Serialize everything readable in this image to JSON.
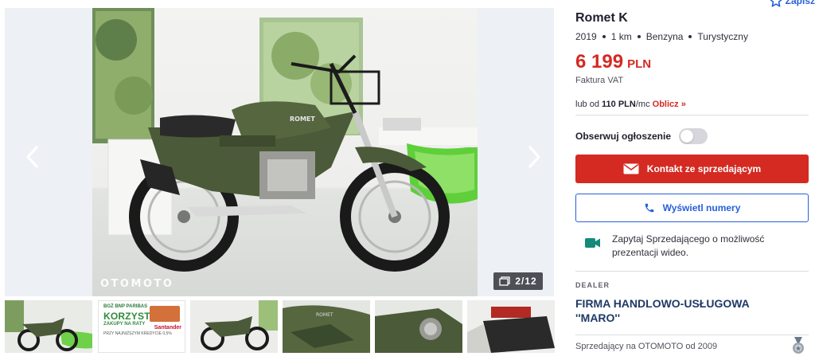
{
  "listing": {
    "title": "Romet K",
    "params": [
      "2019",
      "1 km",
      "Benzyna",
      "Turystyczny"
    ],
    "price_value": "6 199",
    "price_currency": "PLN",
    "vat_note": "Faktura VAT"
  },
  "financing": {
    "prefix": "lub od",
    "amount": "110 PLN",
    "suffix": "/mc",
    "calc_link": "Oblicz »"
  },
  "observe": {
    "label": "Obserwuj ogłoszenie",
    "enabled": false
  },
  "actions": {
    "contact_label": "Kontakt ze sprzedającym",
    "phone_label": "Wyświetl numery",
    "save_label": "Zapisz"
  },
  "video": {
    "text": "Zapytaj Sprzedającego o możliwość prezentacji wideo."
  },
  "dealer": {
    "section_label": "DEALER",
    "name": "FIRMA HANDLOWO-USŁUGOWA ''MARO''",
    "since": "Sprzedający na OTOMOTO od 2009"
  },
  "gallery": {
    "counter": "2/12",
    "watermark": "OTOMOTO",
    "ad": {
      "bank": "BGŻ BNP PARIBAS",
      "headline": "KORZYSTNE",
      "sub": "ZAKUPY NA RATY",
      "fine": "PRZY NAJNIŻSZYM KREDYCIE 0,5%",
      "brand": "Santander"
    }
  },
  "colors": {
    "accent_red": "#d42a22",
    "accent_blue": "#2860d8",
    "dealer_navy": "#1f3a66",
    "video_icon": "#138a7a"
  },
  "icons": {
    "prev": "chevron-left-icon",
    "next": "chevron-right-icon",
    "gallery": "photo-stack-icon",
    "contact": "envelope-icon",
    "phone": "phone-icon",
    "video": "video-camera-icon",
    "save": "star-icon",
    "badge": "medal-icon"
  }
}
